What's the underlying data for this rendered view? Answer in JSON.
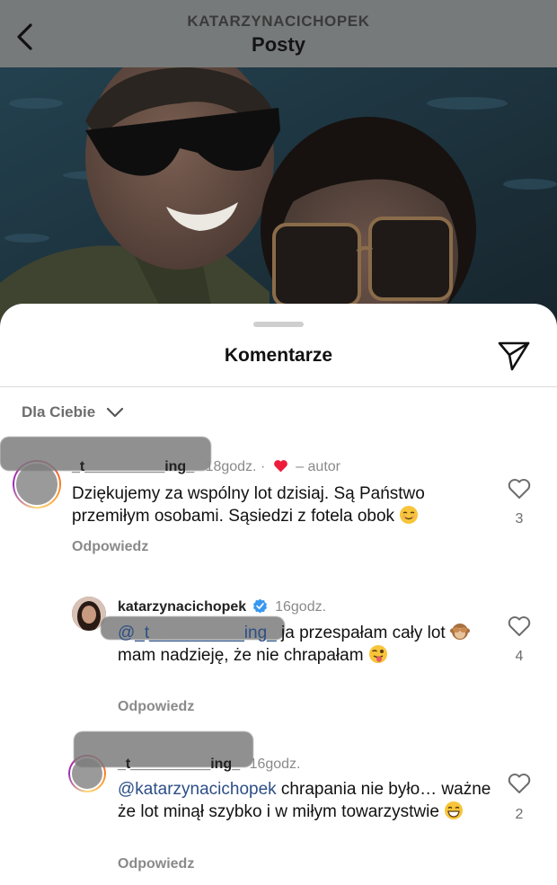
{
  "header": {
    "username": "KATARZYNACICHOPEK",
    "title": "Posty"
  },
  "sheet": {
    "title": "Komentarze",
    "sort_label": "Dla Ciebie"
  },
  "comments": [
    {
      "username": "_t__________ing_",
      "time": "18godz.",
      "author_label": "– autor",
      "liked_by_author": true,
      "text": "Dziękujemy za wspólny lot dzisiaj. Są Państwo przemiłym osobami. Sąsiedzi z fotela obok",
      "emoji": "relieved-face",
      "reply_label": "Odpowiedz",
      "likes": "3"
    },
    {
      "username": "katarzynacichopek",
      "verified": true,
      "time": "16godz.",
      "mention": "@_t__________ing_",
      "text_part1": " ja przespałam cały lot",
      "emoji1": "see-no-evil-monkey",
      "text_part2": " mam nadzieję, że nie chrapałam",
      "emoji2": "winking-face-with-tongue",
      "reply_label": "Odpowiedz",
      "likes": "4"
    },
    {
      "username": "_t__________ing_",
      "time": "16godz.",
      "mention": "@katarzynacichopek",
      "text": " chrapania nie było… ważne że lot minął szybko i w miłym towarzystwie",
      "emoji": "grinning-face-with-smiling-eyes",
      "reply_label": "Odpowiedz",
      "likes": "2"
    }
  ],
  "colors": {
    "header_bg": "#777a7a",
    "mention": "#2c4f86",
    "verified": "#3897f0",
    "heart_red": "#ed1c3b",
    "muted_text": "#8a8a8a"
  }
}
